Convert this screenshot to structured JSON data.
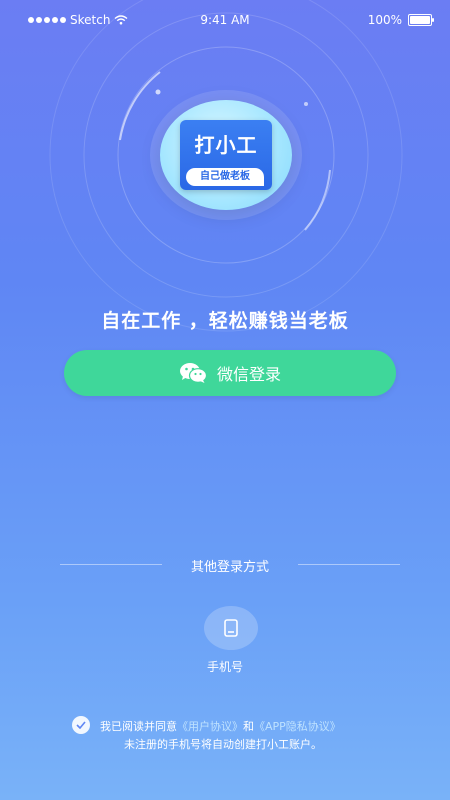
{
  "status_bar": {
    "carrier": "Sketch",
    "time": "9:41 AM",
    "battery": "100%"
  },
  "logo": {
    "title": "打小工",
    "subtitle": "自己做老板"
  },
  "slogan": "自在工作 ，轻松赚钱当老板",
  "wechat_login": {
    "label": "微信登录",
    "icon": "wechat-icon",
    "color": "#3fd79a"
  },
  "other_login": {
    "label": "其他登录方式",
    "phone_label": "手机号",
    "phone_icon": "phone-icon"
  },
  "agreement": {
    "prefix": "我已阅读并同意",
    "user_agreement": "《用户协议》",
    "and": "和",
    "privacy_agreement": "《APP隐私协议》",
    "note": "未注册的手机号将自动创建打小工账户。"
  }
}
